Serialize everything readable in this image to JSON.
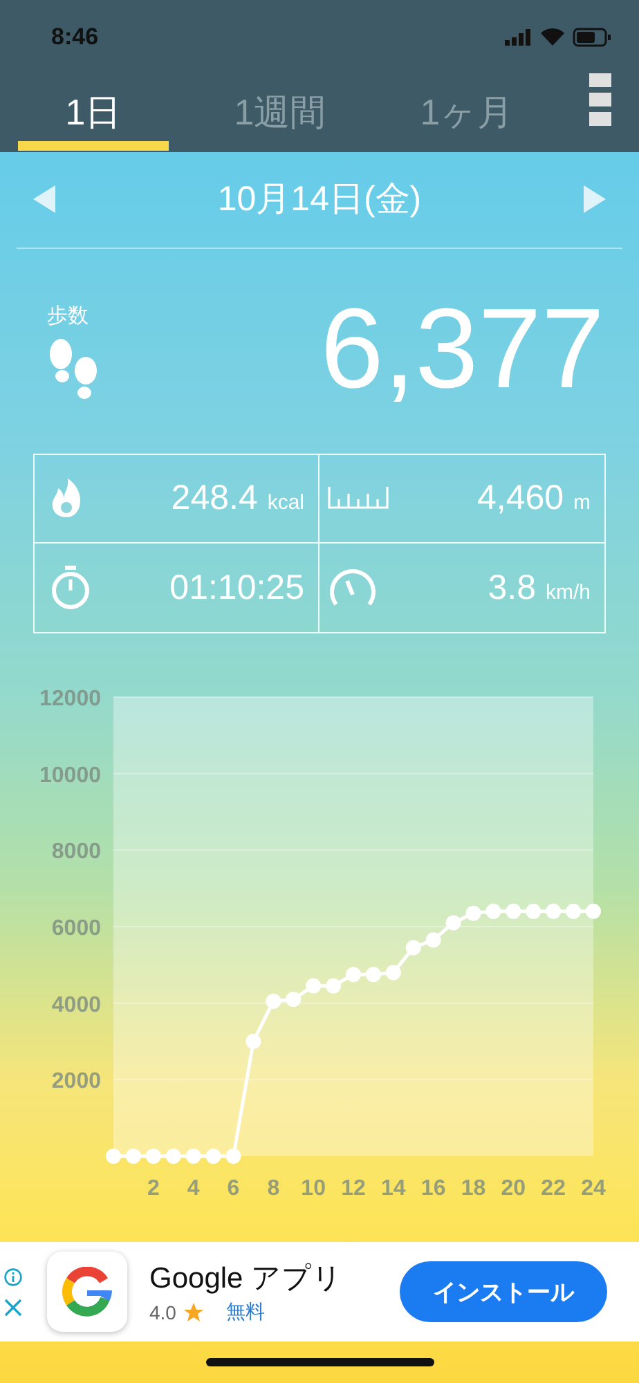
{
  "status_bar": {
    "time": "8:46"
  },
  "tabs": [
    {
      "label": "1日",
      "selected": true
    },
    {
      "label": "1週間",
      "selected": false
    },
    {
      "label": "1ヶ月",
      "selected": false
    }
  ],
  "date_nav": {
    "date": "10月14日(金)"
  },
  "steps": {
    "label": "歩数",
    "value": "6,377"
  },
  "stats": [
    {
      "kind": "calories",
      "value": "248.4",
      "unit": "kcal"
    },
    {
      "kind": "distance",
      "value": "4,460",
      "unit": "m"
    },
    {
      "kind": "duration",
      "value": "01:10:25"
    },
    {
      "kind": "speed",
      "value": "3.8",
      "unit": "km/h"
    }
  ],
  "chart": {
    "chart_data": {
      "type": "line",
      "x": [
        0,
        1,
        2,
        3,
        4,
        5,
        6,
        7,
        8,
        9,
        10,
        11,
        12,
        13,
        14,
        15,
        16,
        17,
        18,
        19,
        20,
        21,
        22,
        23,
        24
      ],
      "values": [
        0,
        0,
        0,
        0,
        0,
        0,
        0,
        3000,
        4050,
        4100,
        4450,
        4450,
        4750,
        4750,
        4800,
        5450,
        5650,
        6100,
        6350,
        6400,
        6400,
        6400,
        6400,
        6400,
        6400
      ],
      "xlim": [
        0,
        24
      ],
      "ylim": [
        0,
        12000
      ],
      "xticks": [
        2,
        4,
        6,
        8,
        10,
        12,
        14,
        16,
        18,
        20,
        22,
        24
      ],
      "yticks": [
        2000,
        4000,
        6000,
        8000,
        10000,
        12000
      ],
      "grid": true,
      "marker": true
    }
  },
  "ad": {
    "title": "Google アプリ",
    "rating": "4.0",
    "price": "無料",
    "button": "インストール"
  }
}
